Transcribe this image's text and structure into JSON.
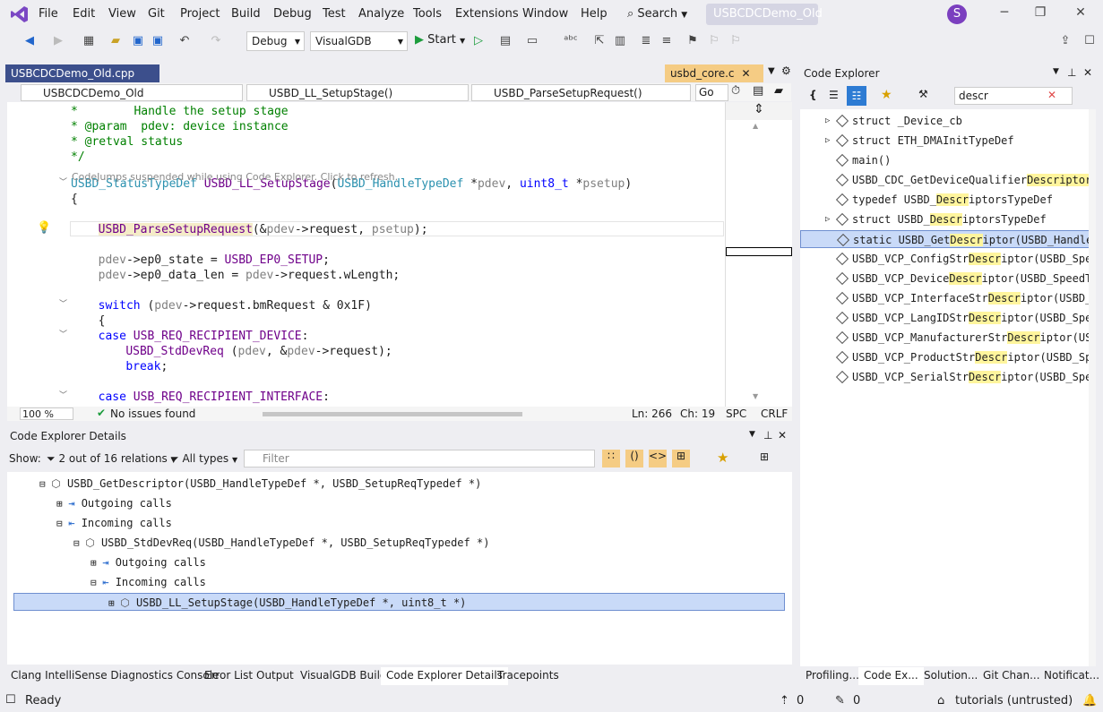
{
  "menu": [
    "File",
    "Edit",
    "View",
    "Git",
    "Project",
    "Build",
    "Debug",
    "Test",
    "Analyze",
    "Tools",
    "Extensions",
    "Window",
    "Help"
  ],
  "search_label": "Search",
  "solution_name": "USBCDCDemo_Old",
  "avatar_letter": "S",
  "toolbar": {
    "config": "Debug",
    "platform": "VisualGDB",
    "start_label": "Start"
  },
  "editor": {
    "tabs": [
      {
        "label": "USBCDCDemo_Old.cpp"
      },
      {
        "label": "usbd_core.c"
      }
    ],
    "nav": [
      "USBCDCDemo_Old",
      "USBD_LL_SetupStage()",
      "USBD_ParseSetupRequest()"
    ],
    "go_label": "Go",
    "codejumps_note": "CodeJumps suspended while using Code Explorer. Click to refresh.",
    "lines": [
      [
        [
          "cm",
          "*        Handle the setup stage"
        ]
      ],
      [
        [
          "cm",
          "* @param  pdev: device instance"
        ]
      ],
      [
        [
          "cm",
          "* @retval status"
        ]
      ],
      [
        [
          "cm",
          "*/"
        ]
      ],
      [
        [
          "ty",
          "USBD_StatusTypeDef"
        ],
        [
          "tx",
          " "
        ],
        [
          "mc",
          "USBD_LL_SetupStage"
        ],
        [
          "tx",
          "("
        ],
        [
          "ty",
          "USBD_HandleTypeDef"
        ],
        [
          "tx",
          " *"
        ],
        [
          "pa",
          "pdev"
        ],
        [
          "tx",
          ", "
        ],
        [
          "kw",
          "uint8_t"
        ],
        [
          "tx",
          " *"
        ],
        [
          "pa",
          "psetup"
        ],
        [
          "tx",
          ")"
        ]
      ],
      [
        [
          "tx",
          "{"
        ]
      ],
      [
        [
          "tx",
          "  "
        ],
        [
          "mc",
          "USBD_ParseSetupRequest"
        ],
        [
          "tx",
          "(&"
        ],
        [
          "pa",
          "pdev"
        ],
        [
          "tx",
          "->request, "
        ],
        [
          "pa",
          "psetup"
        ],
        [
          "tx",
          ");"
        ]
      ],
      [
        [
          "tx",
          "  "
        ],
        [
          "pa",
          "pdev"
        ],
        [
          "tx",
          "->ep0_state = "
        ],
        [
          "mc",
          "USBD_EP0_SETUP"
        ],
        [
          "tx",
          ";"
        ]
      ],
      [
        [
          "tx",
          "  "
        ],
        [
          "pa",
          "pdev"
        ],
        [
          "tx",
          "->ep0_data_len = "
        ],
        [
          "pa",
          "pdev"
        ],
        [
          "tx",
          "->request.wLength;"
        ]
      ],
      [
        [
          "tx",
          "  "
        ],
        [
          "kw",
          "switch"
        ],
        [
          "tx",
          " ("
        ],
        [
          "pa",
          "pdev"
        ],
        [
          "tx",
          "->request.bmRequest & 0x1F)"
        ]
      ],
      [
        [
          "tx",
          "  {"
        ]
      ],
      [
        [
          "tx",
          "  "
        ],
        [
          "kw",
          "case"
        ],
        [
          "tx",
          " "
        ],
        [
          "mc",
          "USB_REQ_RECIPIENT_DEVICE"
        ],
        [
          "tx",
          ":"
        ]
      ],
      [
        [
          "tx",
          "    "
        ],
        [
          "mc",
          "USBD_StdDevReq"
        ],
        [
          "tx",
          " ("
        ],
        [
          "pa",
          "pdev"
        ],
        [
          "tx",
          ", &"
        ],
        [
          "pa",
          "pdev"
        ],
        [
          "tx",
          "->request);"
        ]
      ],
      [
        [
          "tx",
          "    "
        ],
        [
          "kw",
          "break"
        ],
        [
          "tx",
          ";"
        ]
      ],
      [
        [
          "tx",
          "  "
        ],
        [
          "kw",
          "case"
        ],
        [
          "tx",
          " "
        ],
        [
          "mc",
          "USB_REQ_RECIPIENT_INTERFACE"
        ],
        [
          "tx",
          ":"
        ]
      ]
    ],
    "zoom": "100 %",
    "issues": "No issues found",
    "ln": "Ln: 266",
    "ch": "Ch: 19",
    "spc": "SPC",
    "crlf": "CRLF"
  },
  "code_explorer": {
    "title": "Code Explorer",
    "search_value": "descr",
    "items": [
      {
        "parts": [
          [
            "struct _Device_cb",
            ""
          ]
        ]
      },
      {
        "parts": [
          [
            "struct ETH_DMAInitTypeDef",
            ""
          ]
        ]
      },
      {
        "parts": [
          [
            "main()",
            ""
          ]
        ]
      },
      {
        "parts": [
          [
            "USBD_CDC_GetDeviceQualifier",
            "Descriptor",
            "("
          ]
        ]
      },
      {
        "parts": [
          [
            "typedef USBD_",
            "Descr",
            "iptorsTypeDef"
          ]
        ]
      },
      {
        "parts": [
          [
            "struct USBD_",
            "Descr",
            "iptorsTypeDef"
          ]
        ]
      },
      {
        "parts": [
          [
            "static USBD_Get",
            "Descr",
            "iptor(USBD_HandleTy"
          ]
        ]
      },
      {
        "parts": [
          [
            "USBD_VCP_ConfigStr",
            "Descr",
            "iptor(USBD_Speed"
          ]
        ]
      },
      {
        "parts": [
          [
            "USBD_VCP_Device",
            "Descr",
            "iptor(USBD_SpeedTyp"
          ]
        ]
      },
      {
        "parts": [
          [
            "USBD_VCP_InterfaceStr",
            "Descr",
            "iptor(USBD_Sp"
          ]
        ]
      },
      {
        "parts": [
          [
            "USBD_VCP_LangIDStr",
            "Descr",
            "iptor(USBD_Speed"
          ]
        ]
      },
      {
        "parts": [
          [
            "USBD_VCP_ManufacturerStr",
            "Descr",
            "iptor(USBD"
          ]
        ]
      },
      {
        "parts": [
          [
            "USBD_VCP_ProductStr",
            "Descr",
            "iptor(USBD_Spee"
          ]
        ]
      },
      {
        "parts": [
          [
            "USBD_VCP_SerialStr",
            "Descr",
            "iptor(USBD_Speed"
          ]
        ]
      }
    ]
  },
  "details": {
    "title": "Code Explorer Details",
    "show_label": "Show:",
    "relations": "2 out of 16 relations",
    "types": "All types",
    "filter_placeholder": "Filter",
    "tree": [
      "USBD_GetDescriptor(USBD_HandleTypeDef *, USBD_SetupReqTypedef *)",
      "Outgoing calls",
      "Incoming calls",
      "USBD_StdDevReq(USBD_HandleTypeDef *, USBD_SetupReqTypedef *)",
      "Outgoing calls",
      "Incoming calls",
      "USBD_LL_SetupStage(USBD_HandleTypeDef *, uint8_t *)"
    ]
  },
  "bottom_tabs": [
    "Clang IntelliSense Diagnostics Console",
    "Error List",
    "Output",
    "VisualGDB Build",
    "Code Explorer Details",
    "Tracepoints"
  ],
  "right_tabs": [
    "Profiling...",
    "Code Ex...",
    "Solution...",
    "Git Chan...",
    "Notificat..."
  ],
  "status": {
    "ready": "Ready",
    "up": "0",
    "edits": "0",
    "repo": "tutorials (untrusted)"
  }
}
